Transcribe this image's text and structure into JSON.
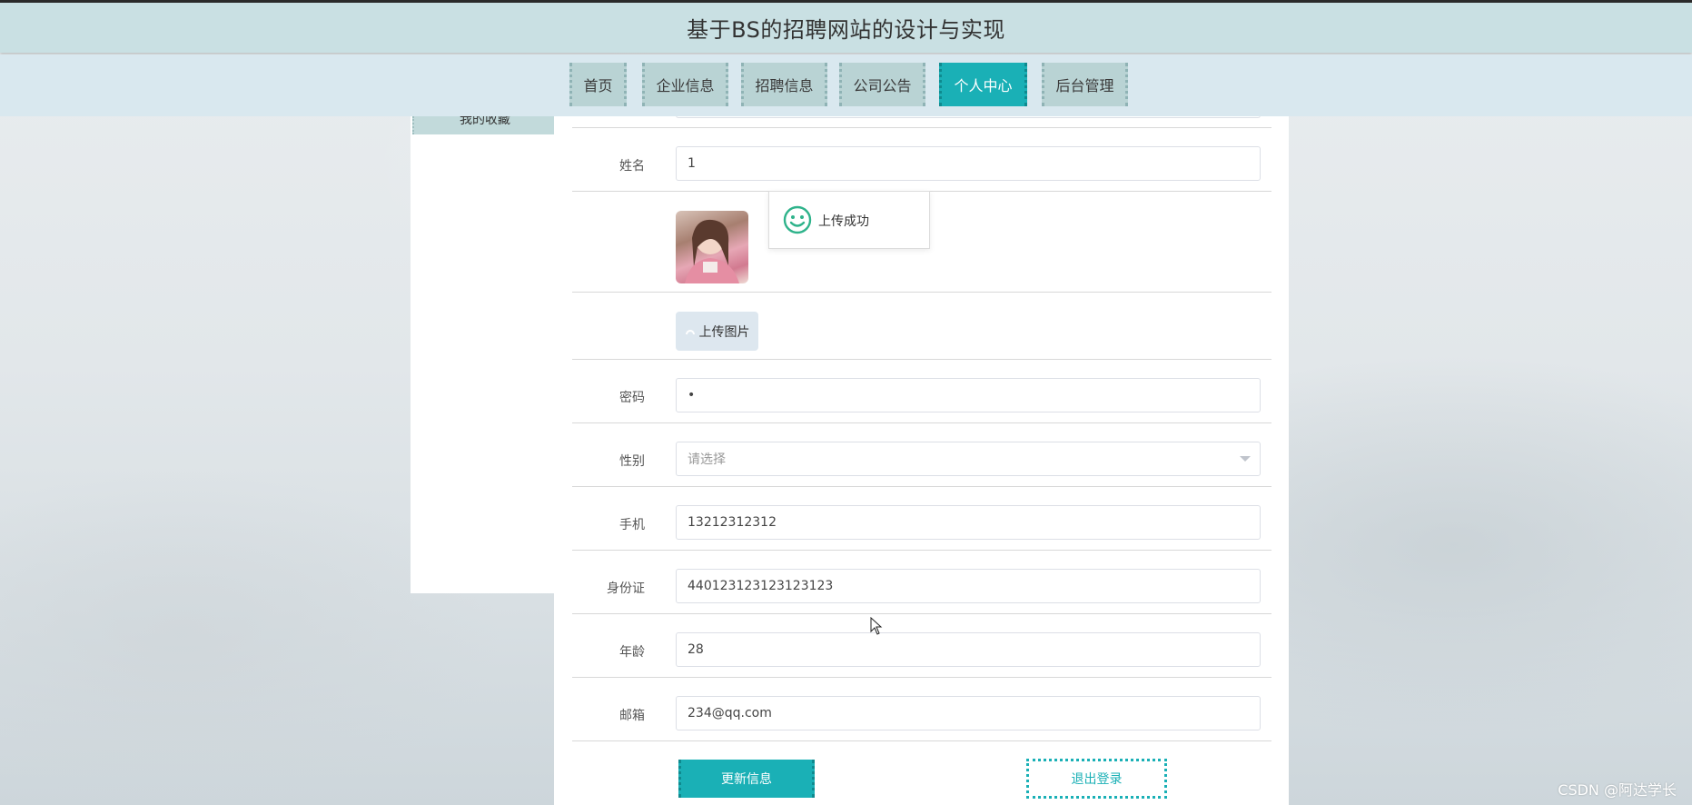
{
  "header": {
    "title": "基于BS的招聘网站的设计与实现"
  },
  "nav": {
    "items": [
      {
        "label": "首页"
      },
      {
        "label": "企业信息"
      },
      {
        "label": "招聘信息"
      },
      {
        "label": "公司公告"
      },
      {
        "label": "个人中心",
        "active": true
      },
      {
        "label": "后台管理"
      }
    ]
  },
  "sidebar": {
    "items": [
      {
        "label": "我的收藏"
      }
    ]
  },
  "form": {
    "name": {
      "label": "姓名",
      "value": "1"
    },
    "upload_toast": "上传成功",
    "upload_button": "上传图片",
    "password": {
      "label": "密码",
      "value": "•"
    },
    "gender": {
      "label": "性别",
      "placeholder": "请选择"
    },
    "phone": {
      "label": "手机",
      "value": "13212312312"
    },
    "id_card": {
      "label": "身份证",
      "value": "440123123123123123"
    },
    "age": {
      "label": "年龄",
      "value": "28"
    },
    "email": {
      "label": "邮箱",
      "value": "234@qq.com"
    },
    "update_button": "更新信息",
    "logout_button": "退出登录"
  },
  "watermark": "CSDN @阿达学长",
  "colors": {
    "accent": "#1ab0b6",
    "nav_bg": "#b9d3d4",
    "title_bar": "#c9e0e3"
  },
  "icons": {
    "toast": "smile-icon",
    "upload": "upload-icon",
    "select": "chevron-down-icon",
    "cursor": "mouse-cursor-icon"
  }
}
